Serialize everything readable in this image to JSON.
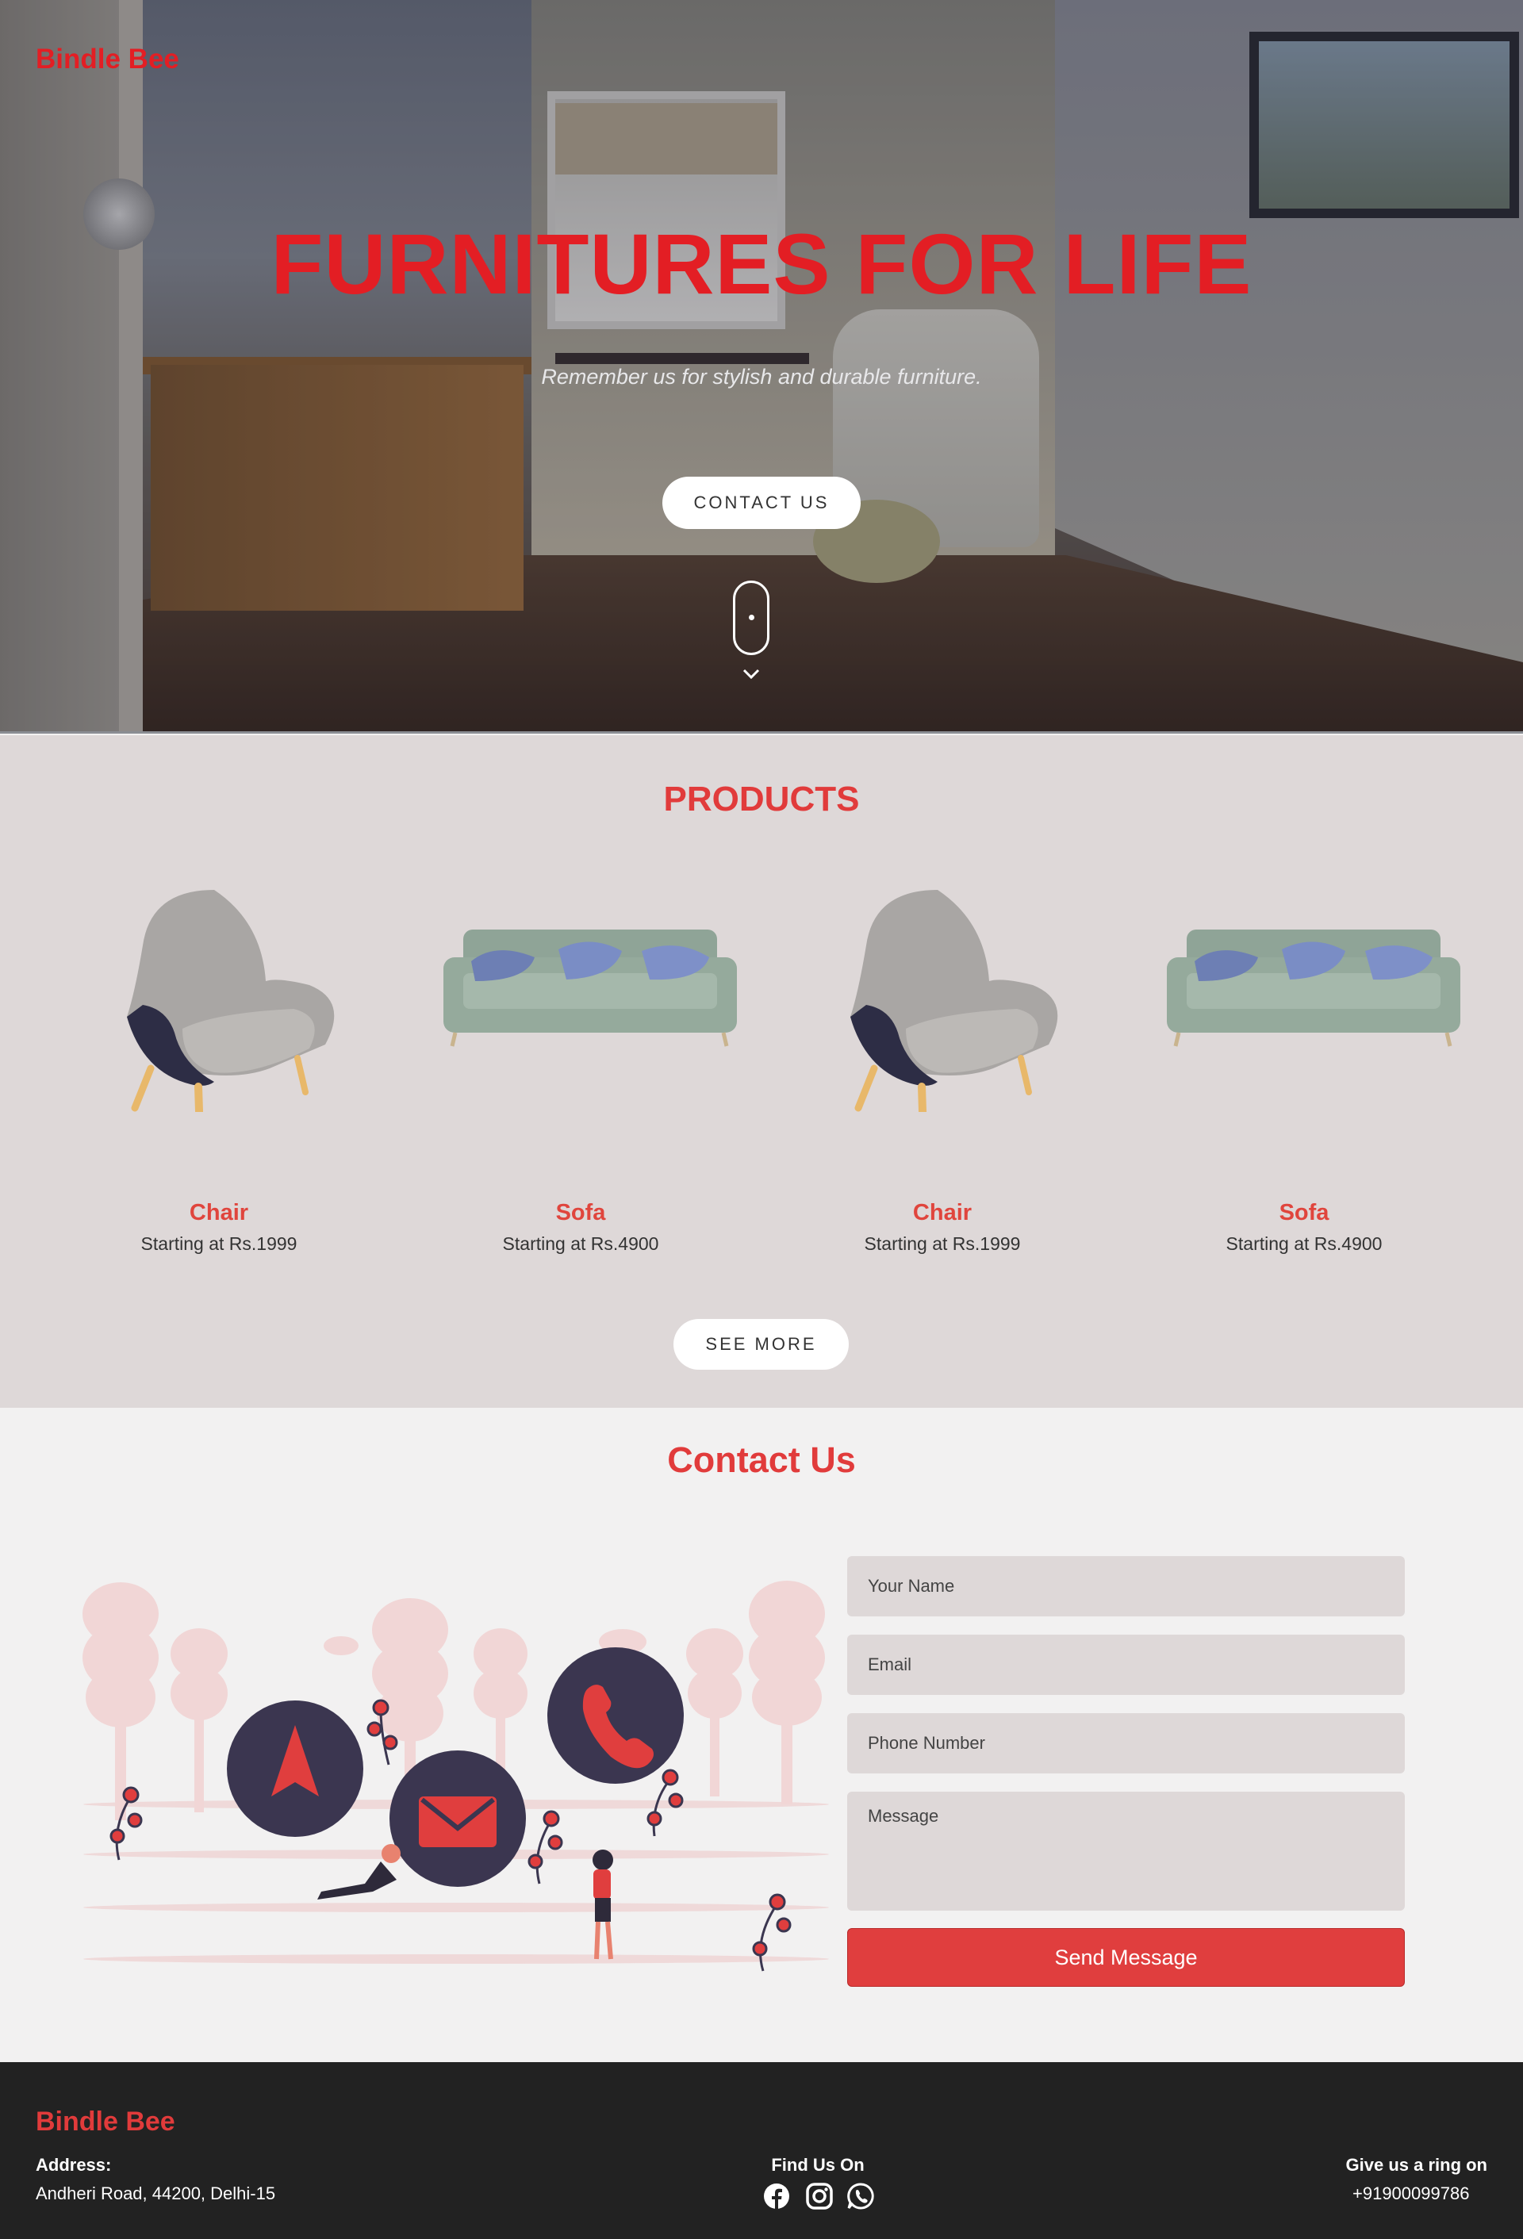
{
  "header": {
    "brand": "Bindle Bee"
  },
  "hero": {
    "title": "FURNITURES FOR LIFE",
    "subtitle": "Remember us for stylish and durable furniture.",
    "cta_label": "CONTACT US"
  },
  "products": {
    "title": "PRODUCTS",
    "items": [
      {
        "name": "Chair",
        "price": "Starting at Rs.1999",
        "image": "armchair"
      },
      {
        "name": "Sofa",
        "price": "Starting at Rs.4900",
        "image": "sofa"
      },
      {
        "name": "Chair",
        "price": "Starting at Rs.1999",
        "image": "armchair"
      },
      {
        "name": "Sofa",
        "price": "Starting at Rs.4900",
        "image": "sofa"
      }
    ],
    "see_more_label": "SEE MORE"
  },
  "contact": {
    "title": "Contact Us",
    "form": {
      "name_placeholder": "Your Name",
      "email_placeholder": "Email",
      "phone_placeholder": "Phone Number",
      "message_placeholder": "Message",
      "submit_label": "Send Message"
    }
  },
  "footer": {
    "brand": "Bindle Bee",
    "address_label": "Address:",
    "address": "Andheri Road, 44200, Delhi-15",
    "find_label": "Find Us On",
    "social_icons": [
      "facebook-icon",
      "instagram-icon",
      "whatsapp-icon"
    ],
    "phone_label": "Give us a ring on",
    "phone": "+91900099786"
  },
  "colors": {
    "accent": "#e31e24",
    "section_title": "#e13b3b",
    "products_bg": "#ded8d8",
    "contact_bg": "#f2f1f1",
    "footer_bg": "#222222",
    "button_red": "#e03e3e",
    "illustration_dark": "#3b3650"
  }
}
